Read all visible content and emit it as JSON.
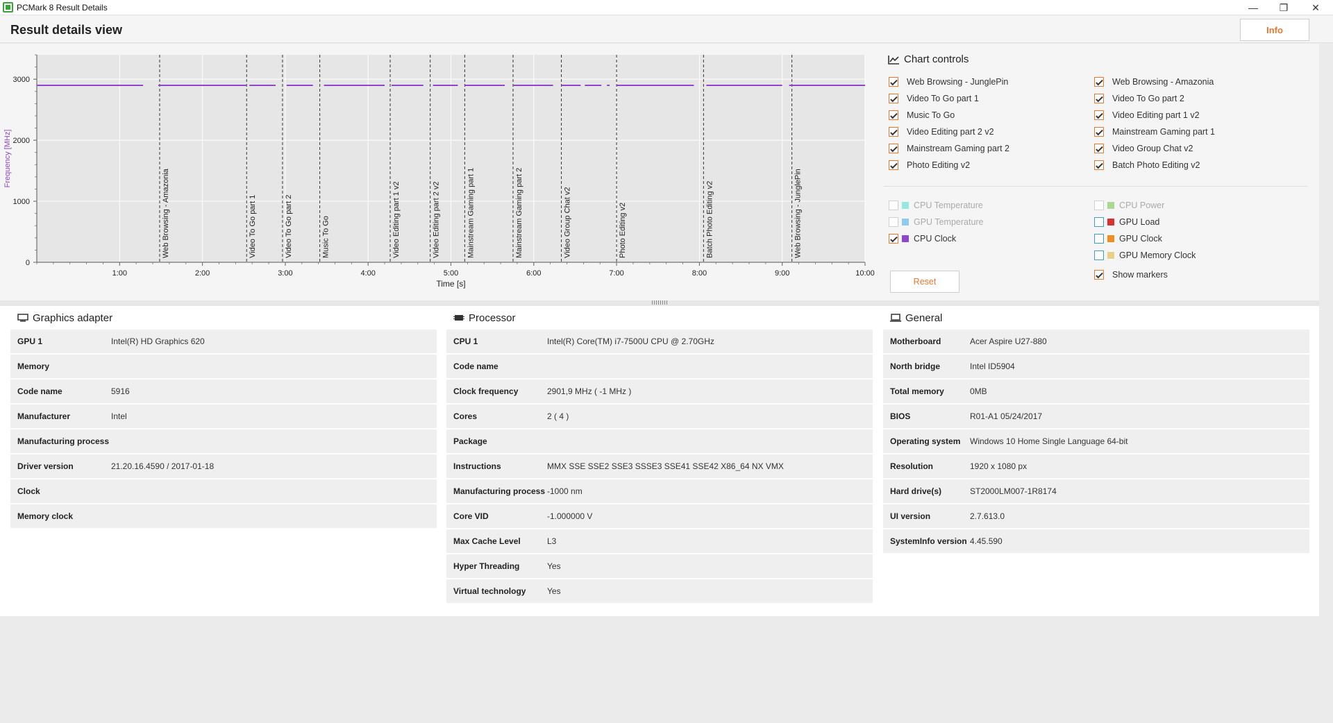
{
  "window": {
    "title": "PCMark 8 Result Details",
    "minimize_glyph": "—",
    "maximize_glyph": "❐",
    "close_glyph": "✕"
  },
  "header": {
    "title": "Result details view",
    "info_label": "Info"
  },
  "chart_data": {
    "type": "line",
    "title": "",
    "xlabel": "Time [s]",
    "ylabel": "Frequency [MHz]",
    "x_ticks": [
      "1:00",
      "2:00",
      "3:00",
      "4:00",
      "5:00",
      "6:00",
      "7:00",
      "8:00",
      "9:00",
      "10:00"
    ],
    "y_ticks": [
      "0",
      "1000",
      "2000",
      "3000"
    ],
    "xlim": [
      "0:00",
      "10:00"
    ],
    "ylim": [
      0,
      3400
    ],
    "series": [
      {
        "name": "CPU Clock",
        "color": "#9046cc",
        "value": 2900,
        "segments": [
          [
            "0:00",
            "1:17"
          ],
          [
            "1:28",
            "2:32"
          ],
          [
            "2:34",
            "2:53"
          ],
          [
            "3:01",
            "3:20"
          ],
          [
            "3:28",
            "4:12"
          ],
          [
            "4:17",
            "4:40"
          ],
          [
            "4:47",
            "5:05"
          ],
          [
            "5:10",
            "5:39"
          ],
          [
            "5:45",
            "6:14"
          ],
          [
            "6:20",
            "6:34"
          ],
          [
            "6:37",
            "6:49"
          ],
          [
            "6:53",
            "6:55"
          ],
          [
            "7:00",
            "7:56"
          ],
          [
            "8:05",
            "9:00"
          ],
          [
            "9:05",
            "10:00"
          ]
        ]
      }
    ],
    "markers": [
      {
        "label": "Web Browsing - Amazonia",
        "x": "1:29"
      },
      {
        "label": "Video To Go part 1",
        "x": "2:32"
      },
      {
        "label": "Video To Go part 2",
        "x": "2:58"
      },
      {
        "label": "Music To Go",
        "x": "3:25"
      },
      {
        "label": "Video Editing part 1 v2",
        "x": "4:16"
      },
      {
        "label": "Video Editing part 2 v2",
        "x": "4:45"
      },
      {
        "label": "Mainstream Gaming part 1",
        "x": "5:10"
      },
      {
        "label": "Mainstream Gaming part 2",
        "x": "5:45"
      },
      {
        "label": "Video Group Chat v2",
        "x": "6:20"
      },
      {
        "label": "Photo Editing v2",
        "x": "7:00"
      },
      {
        "label": "Batch Photo Editing v2",
        "x": "8:03"
      },
      {
        "label": "Web Browsing - JunglePin",
        "x": "9:07"
      }
    ],
    "grid": true
  },
  "chart_controls": {
    "title": "Chart controls",
    "tests_left": [
      {
        "label": "Web Browsing - JunglePin",
        "checked": true
      },
      {
        "label": "Video To Go part 1",
        "checked": true
      },
      {
        "label": "Music To Go",
        "checked": true
      },
      {
        "label": "Video Editing part 2 v2",
        "checked": true
      },
      {
        "label": "Mainstream Gaming part 2",
        "checked": true
      },
      {
        "label": "Photo Editing v2",
        "checked": true
      }
    ],
    "tests_right": [
      {
        "label": "Web Browsing - Amazonia",
        "checked": true
      },
      {
        "label": "Video To Go part 2",
        "checked": true
      },
      {
        "label": "Video Editing part 1 v2",
        "checked": true
      },
      {
        "label": "Mainstream Gaming part 1",
        "checked": true
      },
      {
        "label": "Video Group Chat v2",
        "checked": true
      },
      {
        "label": "Batch Photo Editing v2",
        "checked": true
      }
    ],
    "metrics_left": [
      {
        "label": "CPU Temperature",
        "color": "#3fe0d0",
        "checked": false,
        "enabled": false
      },
      {
        "label": "GPU Temperature",
        "color": "#3aa7e0",
        "checked": false,
        "enabled": false
      },
      {
        "label": "CPU Clock",
        "color": "#9046cc",
        "checked": true,
        "enabled": true
      }
    ],
    "metrics_right": [
      {
        "label": "CPU Power",
        "color": "#70c040",
        "checked": false,
        "enabled": false
      },
      {
        "label": "GPU Load",
        "color": "#d93030",
        "checked": false,
        "enabled": true
      },
      {
        "label": "GPU Clock",
        "color": "#f08c20",
        "checked": false,
        "enabled": true
      },
      {
        "label": "GPU Memory Clock",
        "color": "#e8d088",
        "checked": false,
        "enabled": true
      }
    ],
    "show_markers": {
      "label": "Show markers",
      "checked": true
    },
    "reset_label": "Reset"
  },
  "graphics": {
    "title": "Graphics adapter",
    "rows": [
      {
        "key": "GPU 1",
        "value": "Intel(R) HD Graphics 620"
      },
      {
        "key": "Memory",
        "value": ""
      },
      {
        "key": "Code name",
        "value": "5916"
      },
      {
        "key": "Manufacturer",
        "value": "Intel"
      },
      {
        "key": "Manufacturing process",
        "value": ""
      },
      {
        "key": "Driver version",
        "value": "21.20.16.4590 / 2017-01-18"
      },
      {
        "key": "Clock",
        "value": ""
      },
      {
        "key": "Memory clock",
        "value": ""
      }
    ]
  },
  "processor": {
    "title": "Processor",
    "rows": [
      {
        "key": "CPU 1",
        "value": "Intel(R) Core(TM) i7-7500U CPU @ 2.70GHz"
      },
      {
        "key": "Code name",
        "value": ""
      },
      {
        "key": "Clock frequency",
        "value": "2901,9 MHz ( -1 MHz )"
      },
      {
        "key": "Cores",
        "value": "2 ( 4 )"
      },
      {
        "key": "Package",
        "value": ""
      },
      {
        "key": "Instructions",
        "value": "MMX SSE SSE2 SSE3 SSSE3 SSE41 SSE42 X86_64 NX VMX"
      },
      {
        "key": "Manufacturing process",
        "value": "-1000 nm"
      },
      {
        "key": "Core VID",
        "value": "-1.000000 V"
      },
      {
        "key": "Max Cache Level",
        "value": "L3"
      },
      {
        "key": "Hyper Threading",
        "value": "Yes"
      },
      {
        "key": "Virtual technology",
        "value": "Yes"
      }
    ]
  },
  "general": {
    "title": "General",
    "rows": [
      {
        "key": "Motherboard",
        "value": "Acer Aspire U27-880"
      },
      {
        "key": "North bridge",
        "value": "Intel ID5904"
      },
      {
        "key": "Total memory",
        "value": "0MB"
      },
      {
        "key": "BIOS",
        "value": "R01-A1 05/24/2017"
      },
      {
        "key": "Operating system",
        "value": "Windows 10 Home Single Language 64-bit"
      },
      {
        "key": "Resolution",
        "value": "1920 x 1080 px"
      },
      {
        "key": "Hard drive(s)",
        "value": "ST2000LM007-1R8174"
      },
      {
        "key": "UI version",
        "value": "2.7.613.0"
      },
      {
        "key": "SystemInfo version",
        "value": "4.45.590"
      }
    ]
  },
  "colors": {
    "accent": "#e9782f",
    "cpu_clock": "#9046cc"
  },
  "icons": [
    "app-icon",
    "chart-icon",
    "monitor-icon",
    "cpu-icon",
    "laptop-icon"
  ]
}
